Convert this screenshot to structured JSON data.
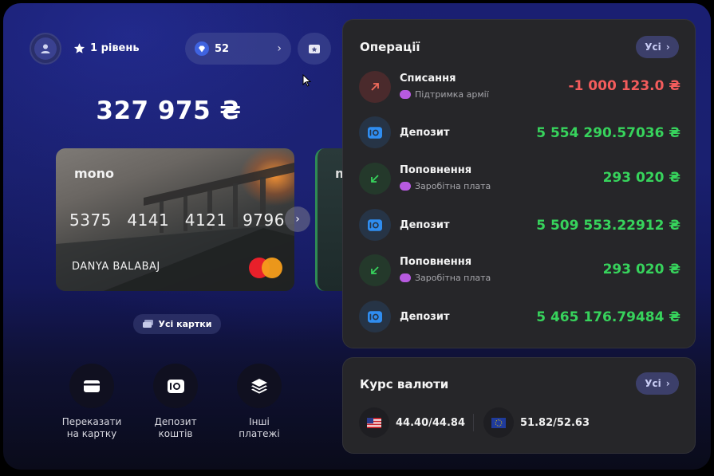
{
  "header": {
    "level_label": "1 рівень",
    "gems_count": "52",
    "balance": "327 975 ₴"
  },
  "card": {
    "brand": "mono",
    "number_groups": [
      "5375",
      "4141",
      "4121",
      "9796"
    ],
    "holder": "DANYA BALABAJ",
    "second_card_brand": "m",
    "all_cards_label": "Усі картки"
  },
  "actions": [
    {
      "label": "Переказати\nна картку",
      "icon": "card-icon"
    },
    {
      "label": "Депозит\nкоштів",
      "icon": "camera-deposit-icon"
    },
    {
      "label": "Інші\nплатежі",
      "icon": "layers-icon"
    }
  ],
  "operations": {
    "title": "Операції",
    "all_label": "Усі",
    "items": [
      {
        "title": "Списання",
        "subtitle": "Підтримка армії",
        "amount": "-1 000 123.0 ₴",
        "type": "debit"
      },
      {
        "title": "Депозит",
        "subtitle": "",
        "amount": "5 554 290.57036 ₴",
        "type": "deposit"
      },
      {
        "title": "Поповнення",
        "subtitle": "Заробітна плата",
        "amount": "293 020 ₴",
        "type": "credit"
      },
      {
        "title": "Депозит",
        "subtitle": "",
        "amount": "5 509 553.22912 ₴",
        "type": "deposit"
      },
      {
        "title": "Поповнення",
        "subtitle": "Заробітна плата",
        "amount": "293 020 ₴",
        "type": "credit"
      },
      {
        "title": "Депозит",
        "subtitle": "",
        "amount": "5 465 176.79484 ₴",
        "type": "deposit"
      }
    ]
  },
  "rates": {
    "title": "Курс валюти",
    "all_label": "Усі",
    "usd": "44.40/44.84",
    "eur": "51.82/52.63"
  },
  "colors": {
    "debit": "#f45c5c",
    "credit": "#37d35c",
    "accent": "#3c3f6a"
  }
}
